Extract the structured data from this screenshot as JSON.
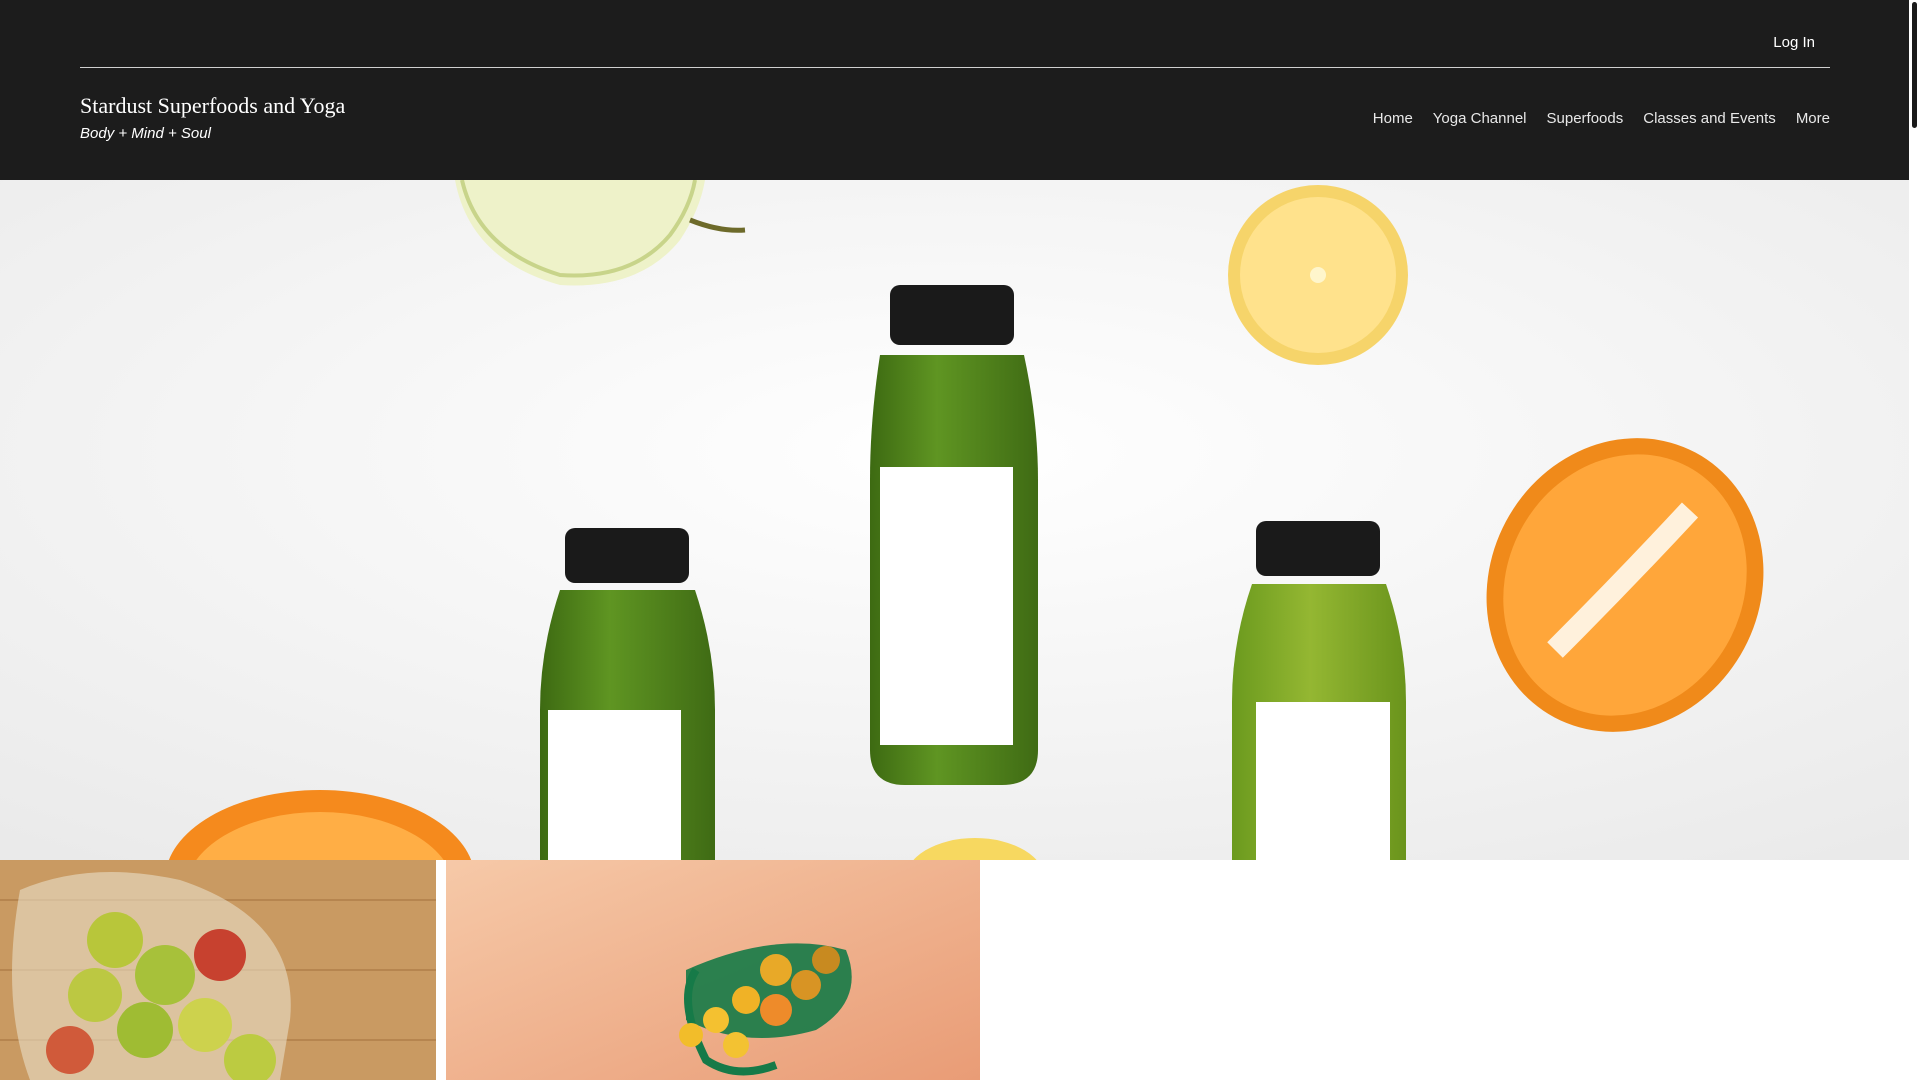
{
  "header": {
    "login_label": "Log In",
    "site_title": "Stardust Superfoods and Yoga",
    "tagline": "Body + Mind + Soul",
    "nav": [
      {
        "label": "Home"
      },
      {
        "label": "Yoga Channel"
      },
      {
        "label": "Superfoods"
      },
      {
        "label": "Classes and Events"
      },
      {
        "label": "More"
      }
    ]
  },
  "colors": {
    "header_bg": "#1c1c1c",
    "header_text": "#ffffff",
    "page_bg": "#ffffff"
  },
  "hero": {
    "image": "green-juice-bottles-with-fruit"
  },
  "gallery": [
    {
      "image": "apples-in-mesh-bag-on-wood"
    },
    {
      "image": "citrus-in-green-mesh-bag"
    }
  ]
}
